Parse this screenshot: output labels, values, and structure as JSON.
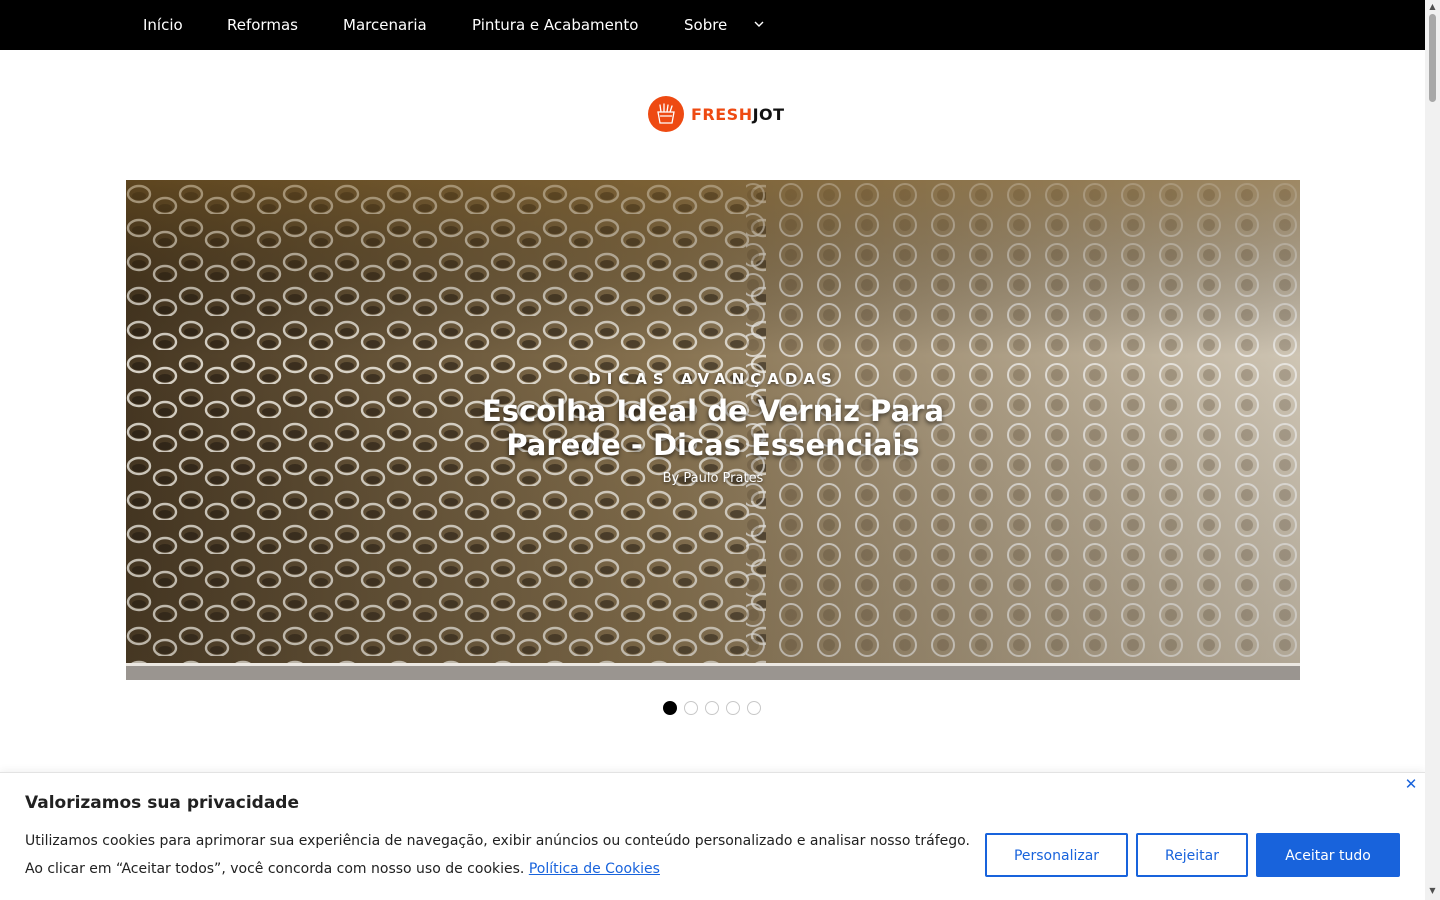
{
  "nav": {
    "items": [
      {
        "label": "Início"
      },
      {
        "label": "Reformas"
      },
      {
        "label": "Marcenaria"
      },
      {
        "label": "Pintura e Acabamento"
      },
      {
        "label": "Sobre"
      }
    ],
    "dropdown_icon": "chevron-down-icon"
  },
  "logo": {
    "part1": "FRESH",
    "part2": "JOT",
    "icon": "fries-icon",
    "color_accent": "#ee4a12"
  },
  "hero": {
    "kicker": "DICAS AVANÇADAS",
    "title": "Escolha Ideal de Verniz Para Parede - Dicas Essenciais",
    "byline": "By Paulo Prates",
    "slide_count": 5,
    "active_slide": 1
  },
  "cookie_banner": {
    "heading": "Valorizamos sua privacidade",
    "text_line1": "Utilizamos cookies para aprimorar sua experiência de navegação, exibir anúncios ou conteúdo personalizado e analisar nosso tráfego.",
    "text_line2": "Ao clicar em “Aceitar todos”, você concorda com nosso uso de cookies.",
    "policy_link": "Política de Cookies",
    "buttons": {
      "customize": "Personalizar",
      "reject": "Rejeitar",
      "accept": "Aceitar tudo"
    },
    "close_icon": "close-icon",
    "accent_color": "#1863dc"
  }
}
